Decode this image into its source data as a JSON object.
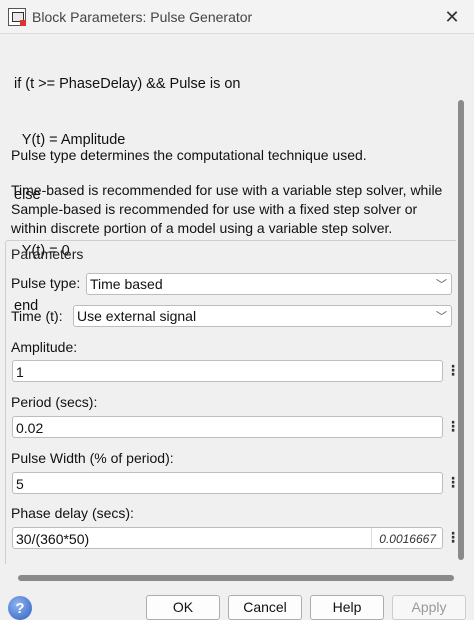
{
  "window": {
    "title": "Block Parameters: Pulse Generator",
    "close_glyph": "✕"
  },
  "description": {
    "pseudocode": [
      "if (t >= PhaseDelay) && Pulse is on",
      "  Y(t) = Amplitude",
      "else",
      "  Y(t) = 0",
      "end"
    ],
    "paragraph1": "Pulse type determines the computational technique used.",
    "paragraph2": "Time-based is recommended for use with a variable step solver, while Sample-based is recommended for use with a fixed step solver or within discrete portion of a model using a variable step solver."
  },
  "parameters": {
    "legend": "Parameters",
    "pulse_type": {
      "label": "Pulse type:",
      "value": "Time based"
    },
    "time": {
      "label": "Time (t):",
      "value": "Use external signal"
    },
    "amplitude": {
      "label": "Amplitude:",
      "value": "1"
    },
    "period": {
      "label": "Period (secs):",
      "value": "0.02"
    },
    "pulse_width": {
      "label": "Pulse Width (% of period):",
      "value": "5"
    },
    "phase_delay": {
      "label": "Phase delay (secs):",
      "value": "30/(360*50)",
      "evaluated": "0.0016667"
    }
  },
  "buttons": {
    "ok": "OK",
    "cancel": "Cancel",
    "help": "Help",
    "apply": "Apply"
  },
  "icons": {
    "help": "help-icon",
    "dropdown": "chevron-down-icon",
    "more": "more-options-icon"
  }
}
